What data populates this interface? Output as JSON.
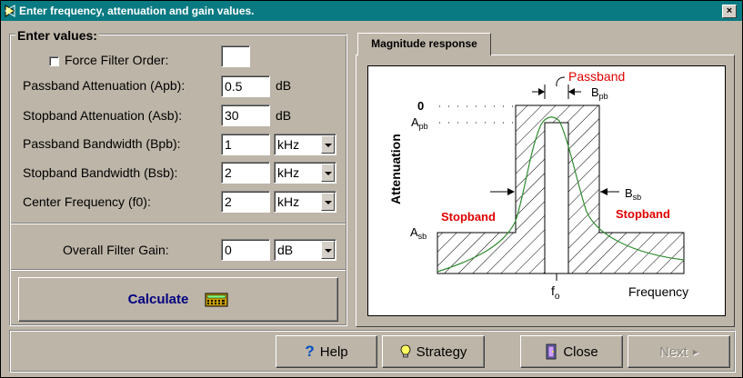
{
  "window": {
    "title": "Enter frequency, attenuation and gain values.",
    "close_glyph": "×"
  },
  "values_group": {
    "title": "Enter values:",
    "force_order": {
      "label": "Force Filter Order:",
      "checked": false,
      "value": ""
    },
    "fields": [
      {
        "label": "Passband Attenuation  (Apb):",
        "value": "0.5",
        "unit": "dB"
      },
      {
        "label": "Stopband Attenuation (Asb):",
        "value": "30",
        "unit": "dB"
      },
      {
        "label": "Passband Bandwidth (Bpb):",
        "value": "1",
        "unit": "kHz"
      },
      {
        "label": "Stopband Bandwidth (Bsb):",
        "value": "2",
        "unit": "kHz"
      },
      {
        "label": "Center Frequency (f0):",
        "value": "2",
        "unit": "kHz"
      }
    ],
    "gain": {
      "label": "Overall Filter Gain:",
      "value": "0",
      "unit": "dB"
    }
  },
  "calculate": {
    "label": "Calculate",
    "color": "#000080"
  },
  "tab": {
    "label": "Magnitude response"
  },
  "diagram": {
    "passband": "Passband",
    "stopband_left": "Stopband",
    "stopband_right": "Stopband",
    "y_axis": "Attenuation",
    "zero": "0",
    "apb_main": "A",
    "apb_sub": "pb",
    "asb_main": "A",
    "asb_sub": "sb",
    "bpb_main": "B",
    "bpb_sub": "pb",
    "bsb_main": "B",
    "bsb_sub": "sb",
    "f0_main": "f",
    "f0_sub": "o",
    "x_axis": "Frequency",
    "accent_red": "#e00000",
    "curve_green": "#2e8b2e"
  },
  "buttons": {
    "help": "Help",
    "strategy": "Strategy",
    "close": "Close",
    "next": "Next"
  }
}
